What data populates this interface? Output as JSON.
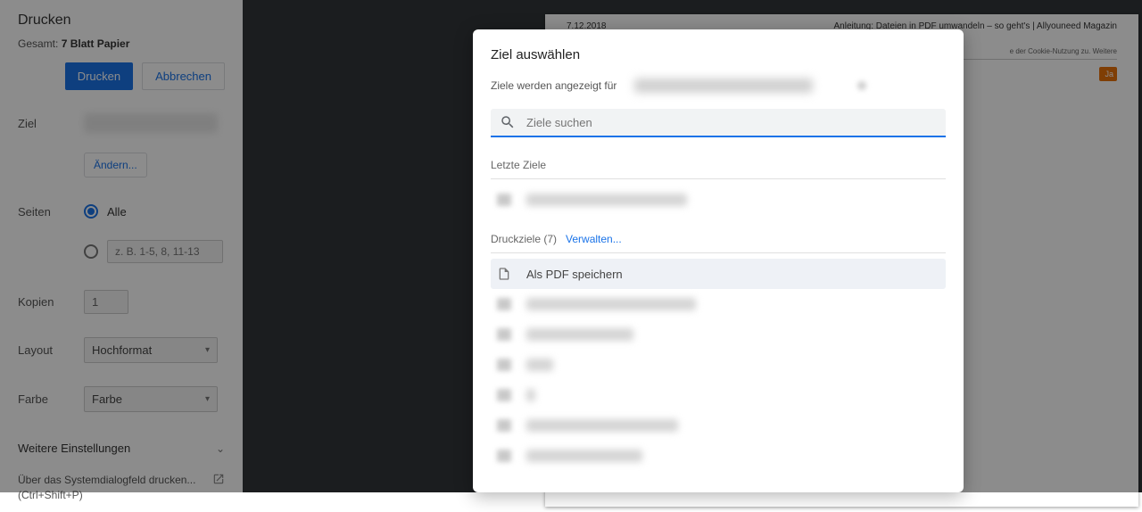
{
  "sidebar": {
    "title": "Drucken",
    "total_prefix": "Gesamt: ",
    "total_value": "7 Blatt Papier",
    "print_btn": "Drucken",
    "cancel_btn": "Abbrechen",
    "ziel_label": "Ziel",
    "change_btn": "Ändern...",
    "seiten_label": "Seiten",
    "pages_all": "Alle",
    "pages_range_placeholder": "z. B. 1-5, 8, 11-13",
    "kopien_label": "Kopien",
    "kopien_value": "1",
    "layout_label": "Layout",
    "layout_value": "Hochformat",
    "farbe_label": "Farbe",
    "farbe_value": "Farbe",
    "more_settings": "Weitere Einstellungen",
    "sysdialog_line1": "Über das Systemdialogfeld drucken...",
    "sysdialog_line2": "(Ctrl+Shift+P)"
  },
  "preview": {
    "date": "7.12.2018",
    "title": "Anleitung: Dateien in PDF umwandeln – so geht's | Allyouneed Magazin",
    "cookie_frag": "e der Cookie-Nutzung zu. Weitere",
    "ja_btn": "Ja"
  },
  "modal": {
    "title": "Ziel auswählen",
    "shown_for": "Ziele werden angezeigt für",
    "search_placeholder": "Ziele suchen",
    "recent_label": "Letzte Ziele",
    "druckziele_label": "Druckziele (7)",
    "manage": "Verwalten...",
    "pdf_option": "Als PDF speichern"
  }
}
